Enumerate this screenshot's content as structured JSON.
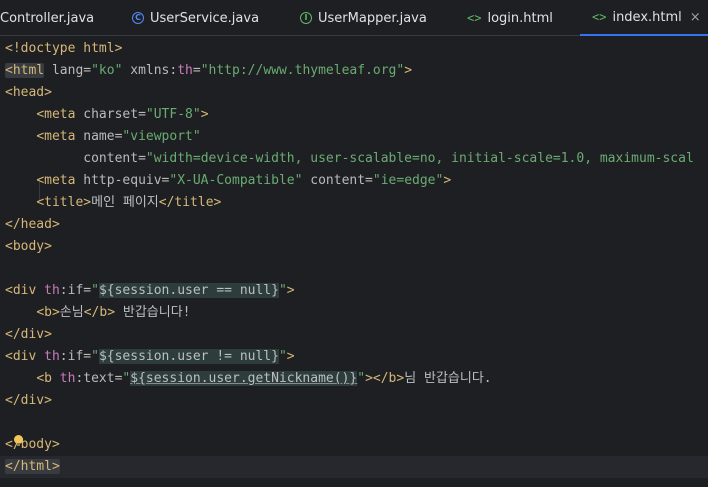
{
  "tabs": [
    {
      "label": "Controller.java",
      "icon": "none"
    },
    {
      "label": "UserService.java",
      "icon": "class-icon",
      "glyph": "C"
    },
    {
      "label": "UserMapper.java",
      "icon": "interface-icon",
      "glyph": "I"
    },
    {
      "label": "login.html",
      "icon": "html-tag-icon",
      "glyph": "<>"
    },
    {
      "label": "index.html",
      "icon": "html-tag-icon",
      "glyph": "<>",
      "active": true,
      "close": "×"
    }
  ],
  "colors": {
    "background": "#1e1f22",
    "tag": "#d5b778",
    "string": "#6aab73",
    "namespace": "#c77dbb",
    "active_tab_underline": "#3574f0"
  },
  "code": {
    "l1": {
      "open": "<!doctype",
      "rest": " html>"
    },
    "l2": {
      "tag": "<html",
      "a1": " lang=",
      "v1": "\"ko\"",
      "a2": " xmlns:",
      "ns": "th",
      "eq": "=",
      "v2": "\"http://www.thymeleaf.org\"",
      "close": ">"
    },
    "l3": {
      "tag": "<head>"
    },
    "l4": {
      "indent": "    ",
      "tag": "<meta",
      "a1": " charset=",
      "v1": "\"UTF-8\"",
      "close": ">"
    },
    "l5": {
      "indent": "    ",
      "tag": "<meta",
      "a1": " name=",
      "v1": "\"viewport\""
    },
    "l6": {
      "indent": "          ",
      "a1": "content=",
      "v1": "\"width=device-width, user-scalable=no, initial-scale=1.0, maximum-scal"
    },
    "l7": {
      "indent": "    ",
      "tag": "<meta",
      "a1": " http-equiv=",
      "v1": "\"X-UA-Compatible\"",
      "a2": " content=",
      "v2": "\"ie=edge\"",
      "close": ">"
    },
    "l8": {
      "indent": "    ",
      "tag": "<title>",
      "text": "메인 페이지",
      "end": "</title>"
    },
    "l9": {
      "tag": "</head>"
    },
    "l10": {
      "tag": "<body>"
    },
    "l12": {
      "tag": "<div",
      "sp": " ",
      "ns": "th",
      "a1": ":if=",
      "q1": "\"",
      "expr": "${session.user == null}",
      "q2": "\"",
      "close": ">"
    },
    "l13": {
      "indent": "    ",
      "tag": "<b>",
      "text": "손님",
      "end": "</b>",
      "rest": " 반갑습니다!"
    },
    "l14": {
      "tag": "</div>"
    },
    "l15": {
      "tag": "<div",
      "sp": " ",
      "ns": "th",
      "a1": ":if=",
      "q1": "\"",
      "expr": "${session.user != null}",
      "q2": "\"",
      "close": ">"
    },
    "l16": {
      "indent": "    ",
      "tag": "<b",
      "sp": " ",
      "ns": "th",
      "a1": ":text=",
      "q1": "\"",
      "expr": "${session.user.getNickname()}",
      "q2": "\"",
      "close": "></b>",
      "rest": "님 반갑습니다."
    },
    "l17": {
      "tag": "</div>"
    },
    "l19": {
      "tag": "</body>"
    },
    "l20": {
      "tag": "</html>"
    }
  }
}
